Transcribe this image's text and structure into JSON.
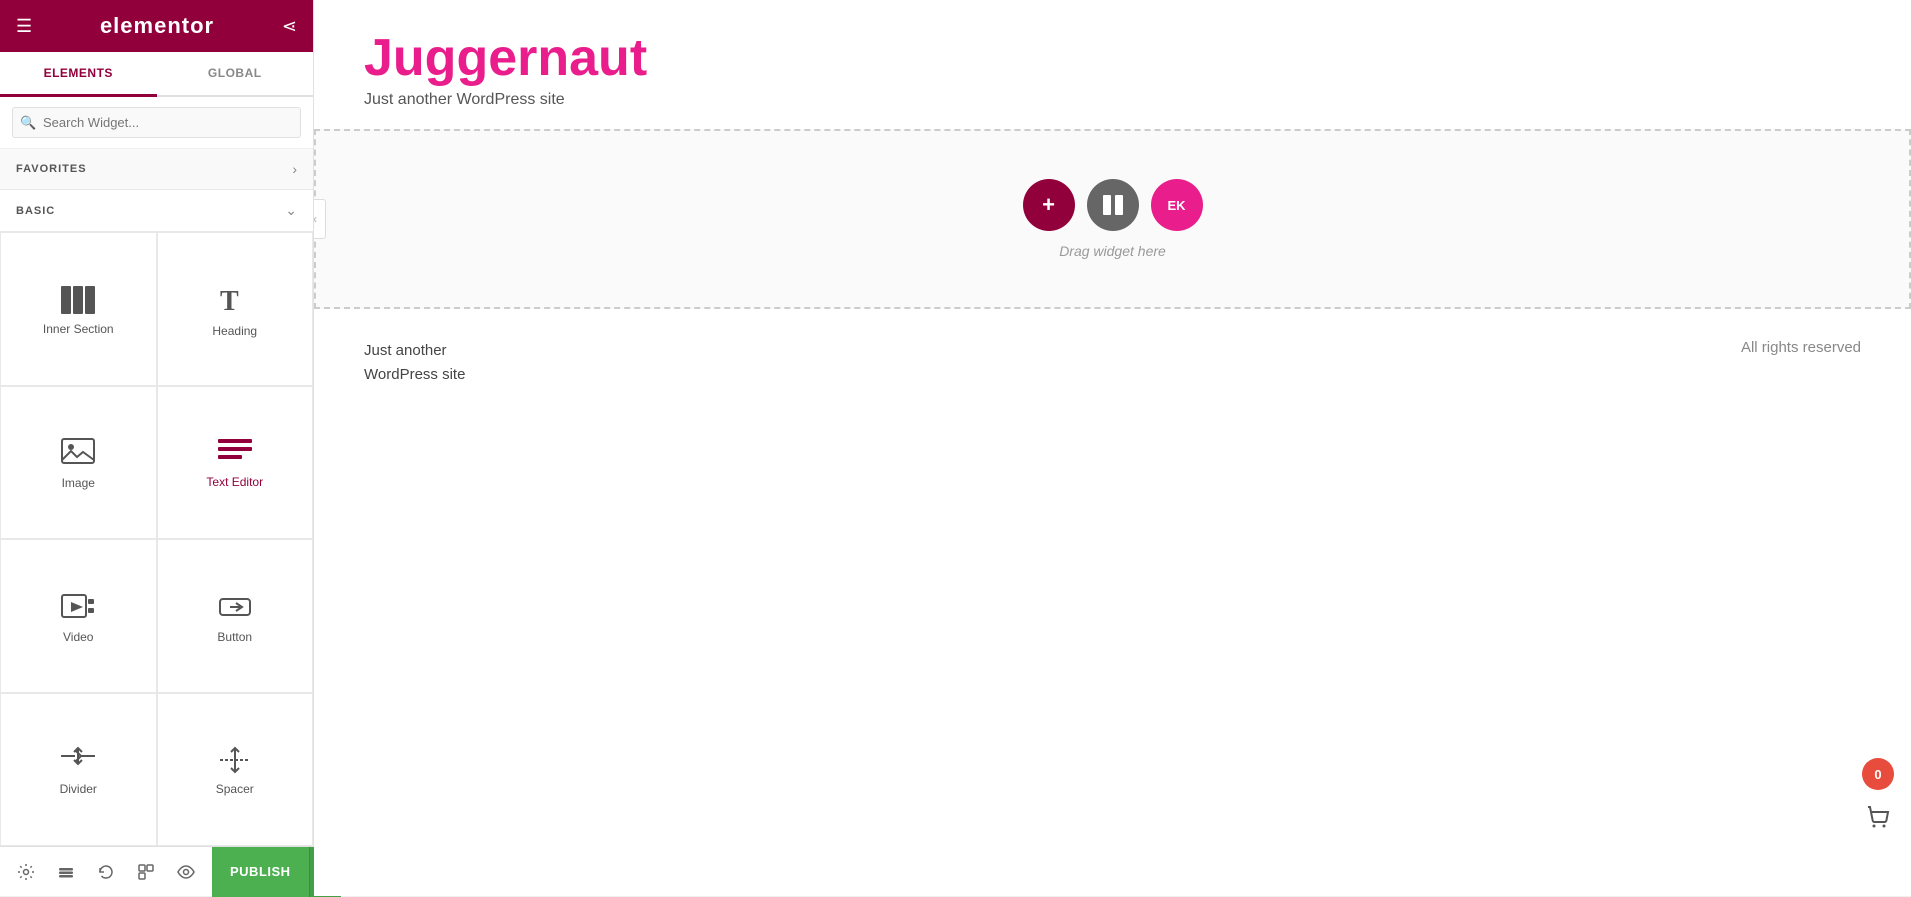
{
  "sidebar": {
    "logo": "elementor",
    "tabs": [
      {
        "id": "elements",
        "label": "ELEMENTS",
        "active": true
      },
      {
        "id": "global",
        "label": "GLOBAL",
        "active": false
      }
    ],
    "search": {
      "placeholder": "Search Widget..."
    },
    "sections": [
      {
        "id": "favorites",
        "label": "FAVORITES",
        "collapsed": true
      },
      {
        "id": "basic",
        "label": "BASIC",
        "collapsed": false
      }
    ],
    "widgets": [
      {
        "id": "inner-section",
        "label": "Inner Section",
        "icon": "inner-section-icon"
      },
      {
        "id": "heading",
        "label": "Heading",
        "icon": "heading-icon"
      },
      {
        "id": "image",
        "label": "Image",
        "icon": "image-icon"
      },
      {
        "id": "text-editor",
        "label": "Text Editor",
        "icon": "text-editor-icon"
      },
      {
        "id": "video",
        "label": "Video",
        "icon": "video-icon"
      },
      {
        "id": "button",
        "label": "Button",
        "icon": "button-icon"
      },
      {
        "id": "divider",
        "label": "Divider",
        "icon": "divider-icon"
      },
      {
        "id": "spacer",
        "label": "Spacer",
        "icon": "spacer-icon"
      }
    ]
  },
  "toolbar": {
    "settings_label": "Settings",
    "layers_label": "Layers",
    "history_label": "History",
    "navigator_label": "Navigator",
    "preview_label": "Preview",
    "publish_label": "PUBLISH"
  },
  "canvas": {
    "site_title": "Juggernaut",
    "site_tagline": "Just another WordPress site",
    "drop_zone_text": "Drag widget here",
    "footer_left_line1": "Just another",
    "footer_left_line2": "WordPress site",
    "footer_right": "All rights reserved"
  },
  "cart": {
    "count": "0"
  }
}
